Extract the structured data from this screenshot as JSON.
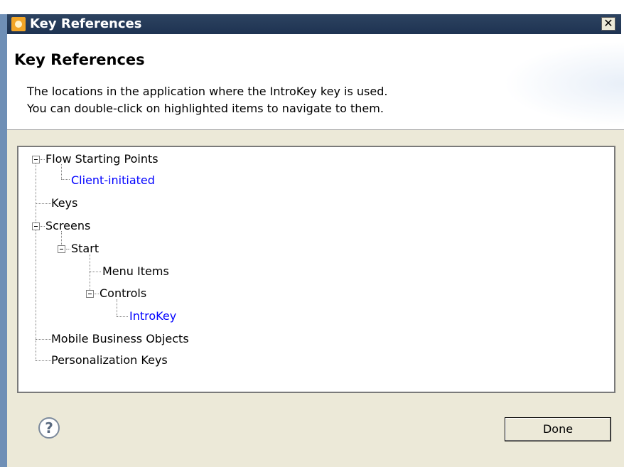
{
  "window": {
    "title": "Key References"
  },
  "header": {
    "title": "Key References",
    "description_line1": "The locations in the application where the IntroKey key is used.",
    "description_line2": "You can double-click on highlighted items to navigate to them."
  },
  "tree": {
    "nodes": [
      {
        "label": "Flow Starting Points",
        "expanded": true,
        "highlighted": false
      },
      {
        "label": "Client-initiated",
        "highlighted": true
      },
      {
        "label": "Keys",
        "highlighted": false
      },
      {
        "label": "Screens",
        "expanded": true,
        "highlighted": false
      },
      {
        "label": "Start",
        "expanded": true,
        "highlighted": false
      },
      {
        "label": "Menu Items",
        "highlighted": false
      },
      {
        "label": "Controls",
        "expanded": true,
        "highlighted": false
      },
      {
        "label": "IntroKey",
        "highlighted": true
      },
      {
        "label": "Mobile Business Objects",
        "highlighted": false
      },
      {
        "label": "Personalization Keys",
        "highlighted": false
      }
    ]
  },
  "footer": {
    "help_icon": "?",
    "done_label": "Done"
  },
  "colors": {
    "title_bar": "#2d4360",
    "link": "#0000ff",
    "dialog_background": "#ece9d8"
  },
  "icons": {
    "app": "app-icon",
    "close": "close-icon",
    "help": "help-icon",
    "expander": "collapse-icon"
  }
}
